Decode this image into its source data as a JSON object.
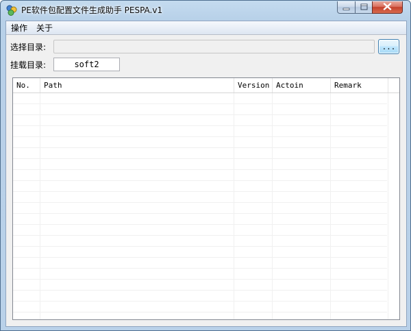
{
  "window": {
    "title": "PE软件包配置文件生成助手 PESPA.v1"
  },
  "menu": {
    "items": [
      {
        "label": "操作"
      },
      {
        "label": "关于"
      }
    ]
  },
  "form": {
    "select_dir_label": "选择目录:",
    "select_dir_value": "",
    "browse_label": "...",
    "mount_dir_label": "挂载目录:",
    "mount_dir_value": "soft2"
  },
  "table": {
    "columns": [
      "No.",
      "Path",
      "Version",
      "Actoin",
      "Remark"
    ],
    "rows": []
  },
  "colors": {
    "frame": "#b9d1e9",
    "client": "#f0f0f0",
    "close_button": "#c4412c"
  },
  "icons": {
    "app": "app-icon",
    "minimize": "minimize-icon",
    "maximize": "maximize-icon",
    "close": "close-icon"
  }
}
